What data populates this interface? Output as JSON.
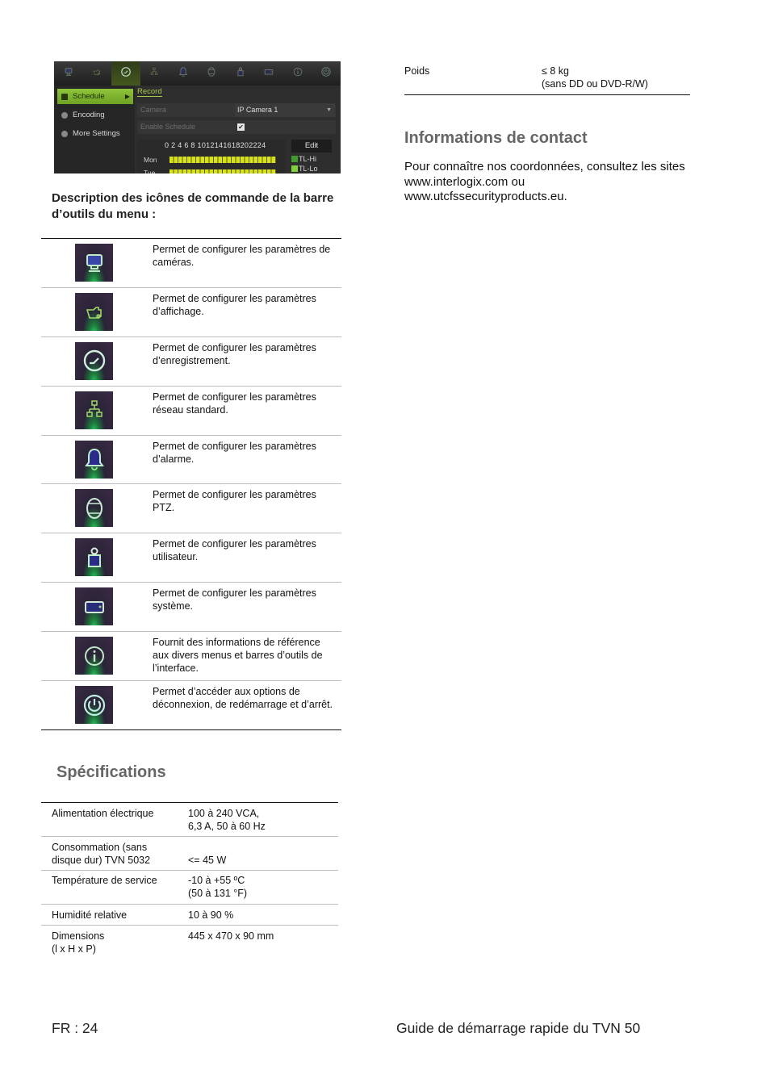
{
  "dvr_screenshot": {
    "toolbar_icons": [
      "camera-icon",
      "display-icon",
      "record-icon",
      "network-icon",
      "alarm-icon",
      "ptz-icon",
      "user-icon",
      "system-icon",
      "info-icon",
      "power-icon"
    ],
    "active_toolbar_index": 2,
    "sidebar": [
      {
        "label": "Schedule",
        "active": true
      },
      {
        "label": "Encoding",
        "active": false
      },
      {
        "label": "More Settings",
        "active": false
      }
    ],
    "tab": "Record",
    "camera_label": "Camera",
    "camera_value": "IP Camera 1",
    "enable_schedule_label": "Enable Schedule",
    "enable_schedule_checked": "✔",
    "hours": "0  2  4  6  8  1012141618202224",
    "days": [
      "Mon",
      "Tue"
    ],
    "edit_label": "Edit",
    "legend": [
      {
        "label": "TL-Hi",
        "color": "#3f9a2f"
      },
      {
        "label": "TL-Lo",
        "color": "#7fd23a"
      }
    ],
    "colors": {
      "accent": "#8fc43a",
      "bar": "#d8e21a"
    }
  },
  "icons_section": {
    "heading": "Description des icônes de commande de la barre d’outils du menu :",
    "rows": [
      {
        "icon": "camera-icon",
        "text": "Permet de configurer les paramètres de caméras."
      },
      {
        "icon": "display-icon",
        "text": "Permet de configurer les paramètres d’affichage."
      },
      {
        "icon": "record-icon",
        "text": "Permet de configurer les paramètres d’enregistrement."
      },
      {
        "icon": "network-icon",
        "text": "Permet de configurer les paramètres réseau standard."
      },
      {
        "icon": "alarm-icon",
        "text": "Permet de configurer les paramètres d’alarme."
      },
      {
        "icon": "ptz-icon",
        "text": "Permet de configurer les paramètres PTZ."
      },
      {
        "icon": "user-icon",
        "text": "Permet de configurer les paramètres utilisateur."
      },
      {
        "icon": "system-icon",
        "text": "Permet de configurer les paramètres système."
      },
      {
        "icon": "info-icon",
        "text": "Fournit des informations de référence aux divers menus et barres d’outils de l’interface."
      },
      {
        "icon": "power-icon",
        "text": "Permet d’accéder aux options de déconnexion, de redémarrage et d’arrêt."
      }
    ]
  },
  "specifications": {
    "heading": "Spécifications",
    "rows": [
      {
        "key": "Alimentation électrique",
        "value": "100 à 240 VCA,\n6,3 A, 50 à 60 Hz"
      },
      {
        "key": "Consommation (sans disque dur) TVN 5032",
        "value": "<= 45 W"
      },
      {
        "key": "Température de service",
        "value": "-10 à +55 ºC\n(50 à 131 °F)"
      },
      {
        "key": "Humidité relative",
        "value": "10 à 90 %"
      },
      {
        "key": "Dimensions\n(l x H x P)",
        "value": "445 x 470 x 90 mm"
      }
    ],
    "weight": {
      "key": "Poids",
      "value": "≤ 8 kg\n(sans DD ou DVD-R/W)"
    }
  },
  "contact": {
    "heading": "Informations de contact",
    "text": "Pour connaître nos coordonnées, consultez les sites www.interlogix.com ou www.utcfssecurityproducts.eu."
  },
  "footer": {
    "page": "FR : 24",
    "title": "Guide de démarrage rapide du TVN 50"
  }
}
